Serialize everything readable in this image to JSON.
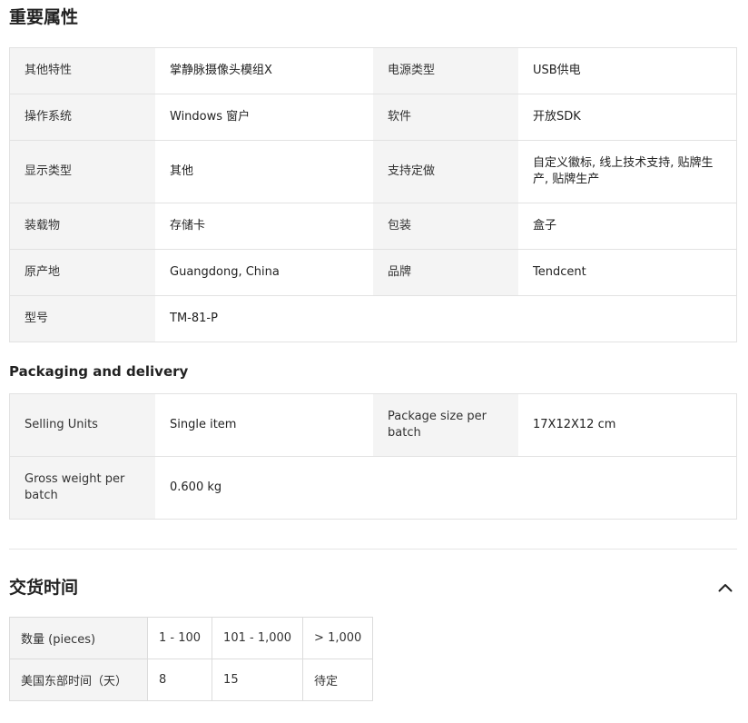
{
  "key_attributes": {
    "title": "重要属性",
    "rows": [
      [
        {
          "k": "其他特性",
          "v": "掌静脉摄像头模组X"
        },
        {
          "k": "电源类型",
          "v": "USB供电"
        }
      ],
      [
        {
          "k": "操作系统",
          "v": "Windows 窗户"
        },
        {
          "k": "软件",
          "v": "开放SDK"
        }
      ],
      [
        {
          "k": "显示类型",
          "v": "其他"
        },
        {
          "k": "支持定做",
          "v": "自定义徽标, 线上技术支持, 贴牌生产, 贴牌生产"
        }
      ],
      [
        {
          "k": "装载物",
          "v": "存储卡"
        },
        {
          "k": "包装",
          "v": "盒子"
        }
      ],
      [
        {
          "k": "原产地",
          "v": "Guangdong, China"
        },
        {
          "k": "品牌",
          "v": "Tendcent"
        }
      ],
      [
        {
          "k": "型号",
          "v": "TM-81-P"
        }
      ]
    ]
  },
  "packaging": {
    "title": "Packaging and delivery",
    "rows": [
      [
        {
          "k": "Selling Units",
          "v": "Single item"
        },
        {
          "k": "Package size per batch",
          "v": "17X12X12 cm"
        }
      ],
      [
        {
          "k": "Gross weight per batch",
          "v": "0.600 kg"
        }
      ]
    ]
  },
  "lead_time": {
    "title": "交货时间",
    "collapse_icon": "chevron-up-icon",
    "quantity_label": "数量 (pieces)",
    "quantities": [
      "1 - 100",
      "101 - 1,000",
      "> 1,000"
    ],
    "time_label": "美国东部时间（天）",
    "times": [
      "8",
      "15",
      "待定"
    ]
  }
}
